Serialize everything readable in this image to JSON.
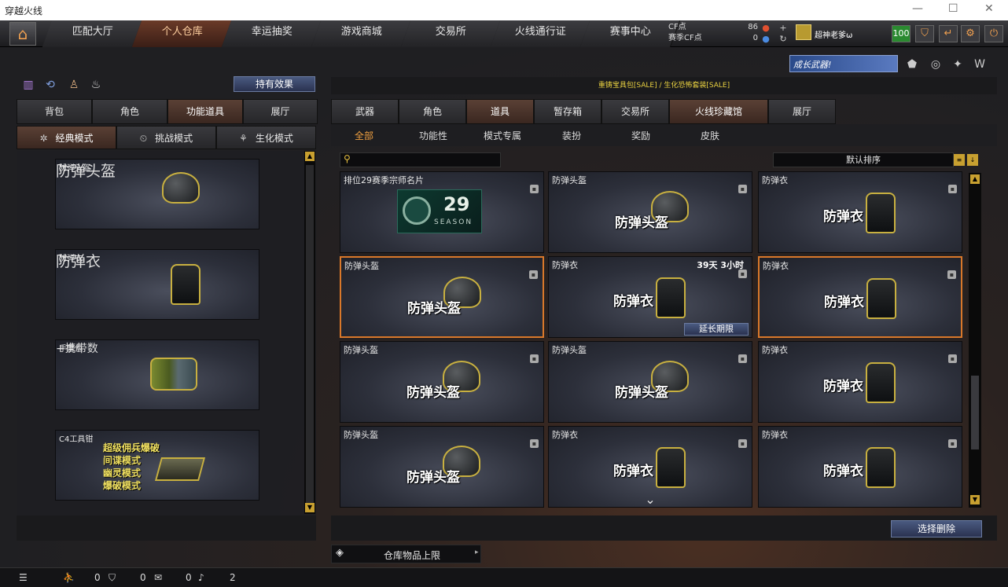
{
  "window": {
    "title": "穿越火线"
  },
  "nav": {
    "tabs": [
      "匹配大厅",
      "个人仓库",
      "幸运抽奖",
      "游戏商城",
      "交易所",
      "火线通行证",
      "赛事中心"
    ],
    "cf_label": "CF点",
    "cf_value": "86",
    "season_cf_label": "赛季CF点",
    "season_cf_value": "0",
    "player_name": "超神老爹ω",
    "level_badge": "100"
  },
  "promo": {
    "growth_weapon": "成长武器!",
    "banner_text": "重铸宝具包[SALE] / 生化恐怖套装[SALE]"
  },
  "left": {
    "effect_button": "持有效果",
    "tabs": [
      "背包",
      "角色",
      "功能道具",
      "展厅"
    ],
    "mode_tabs": [
      "经典模式",
      "挑战模式",
      "生化模式"
    ],
    "slots": [
      {
        "title": "防弹头盔",
        "big": "防弹头盔"
      },
      {
        "title": "防弹衣",
        "big": "防弹衣"
      },
      {
        "title": "手雷包",
        "big": "+携带数"
      },
      {
        "title": "C4工具钳",
        "lines": [
          "超级佣兵爆破",
          "间谍模式",
          "幽灵模式",
          "爆破模式"
        ]
      }
    ]
  },
  "right": {
    "tabs": [
      "武器",
      "角色",
      "道具",
      "暂存箱",
      "交易所",
      "火线珍藏馆",
      "展厅"
    ],
    "subtabs": [
      "全部",
      "功能性",
      "模式专属",
      "装扮",
      "奖励",
      "皮肤"
    ],
    "sort_label": "默认排序",
    "items": [
      {
        "title": "排位29赛季宗师名片",
        "kind": "season",
        "season_num": "29",
        "season_word": "SEASON"
      },
      {
        "title": "防弹头盔",
        "kind": "helmet",
        "big": "防弹头盔"
      },
      {
        "title": "防弹衣",
        "kind": "vest",
        "big": "防弹衣"
      },
      {
        "title": "防弹头盔",
        "kind": "helmet",
        "big": "防弹头盔",
        "selected": true
      },
      {
        "title": "防弹衣",
        "kind": "vest",
        "big": "防弹衣",
        "time": "39天 3小时",
        "extend": "延长期限"
      },
      {
        "title": "防弹衣",
        "kind": "vest",
        "big": "防弹衣",
        "selected": true
      },
      {
        "title": "防弹头盔",
        "kind": "helmet",
        "big": "防弹头盔"
      },
      {
        "title": "防弹头盔",
        "kind": "helmet",
        "big": "防弹头盔"
      },
      {
        "title": "防弹衣",
        "kind": "vest",
        "big": "防弹衣"
      },
      {
        "title": "防弹头盔",
        "kind": "helmet",
        "big": "防弹头盔"
      },
      {
        "title": "防弹衣",
        "kind": "vest",
        "big": "防弹衣"
      },
      {
        "title": "防弹衣",
        "kind": "vest",
        "big": "防弹衣"
      }
    ],
    "delete_button": "选择删除",
    "capacity_label": "仓库物品上限"
  },
  "bottom": {
    "v1": "0",
    "v2": "0",
    "v3": "0",
    "v4": "2"
  }
}
